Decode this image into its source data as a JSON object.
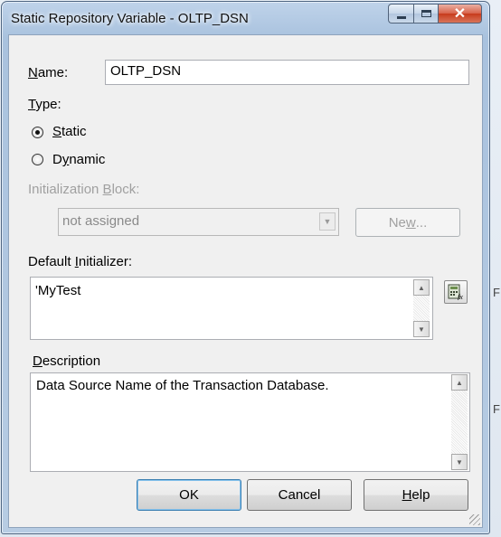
{
  "window": {
    "title": "Static Repository Variable - OLTP_DSN"
  },
  "form": {
    "name_label_u": "N",
    "name_label_rest": "ame:",
    "name_value": "OLTP_DSN",
    "type_label_u": "T",
    "type_label_rest": "ype:",
    "static_u": "S",
    "static_rest": "tatic",
    "dynamic_pre": "D",
    "dynamic_u": "y",
    "dynamic_rest": "namic",
    "init_block_pre": "Initialization ",
    "init_block_u": "B",
    "init_block_rest": "lock:",
    "init_block_value": "not assigned",
    "new_pre": "Ne",
    "new_u": "w",
    "new_rest": "...",
    "default_init_pre": "Default ",
    "default_init_u": "I",
    "default_init_rest": "nitializer:",
    "default_init_value": "'MyTest",
    "description_u": "D",
    "description_rest": "escription",
    "description_value": "Data Source Name of the Transaction Database."
  },
  "buttons": {
    "ok": "OK",
    "cancel": "Cancel",
    "help_u": "H",
    "help_rest": "elp"
  },
  "background": {
    "frag1": "F",
    "frag2": "F"
  },
  "selected_type": "Static"
}
